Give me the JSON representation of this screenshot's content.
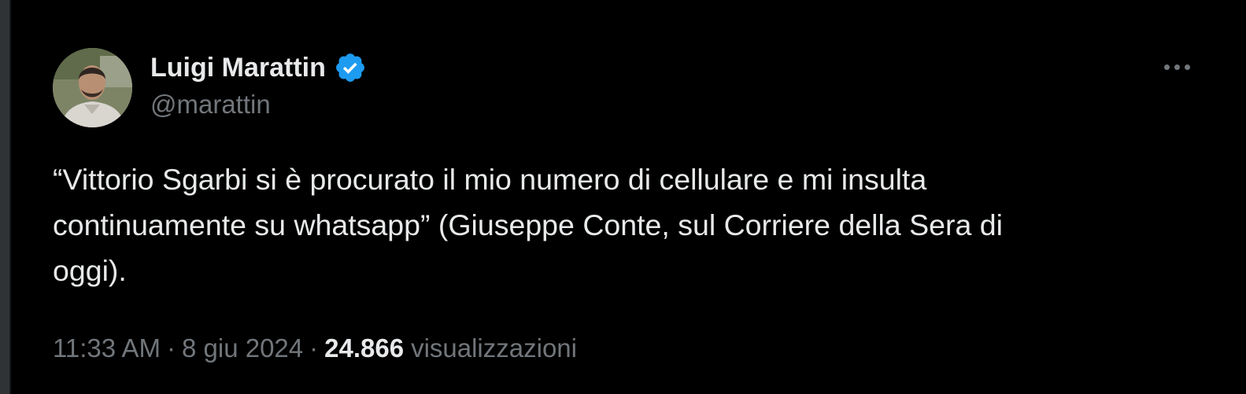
{
  "tweet": {
    "author": {
      "display_name": "Luigi Marattin",
      "handle": "@marattin",
      "verified": true
    },
    "text": "“Vittorio Sgarbi si è procurato il mio numero di cellulare e mi insulta\ncontinuamente su whatsapp” (Giuseppe Conte, sul Corriere della Sera di\noggi).",
    "time": "11:33 AM",
    "separator": "·",
    "date": "8 giu 2024",
    "views_count": "24.866",
    "views_label": "visualizzazioni"
  },
  "colors": {
    "background": "#000000",
    "primary_text": "#e7e9ea",
    "secondary_text": "#71767b",
    "verified_blue": "#1d9bf0"
  },
  "icons": {
    "verified": "verified-badge-icon",
    "more": "more-options-icon"
  }
}
